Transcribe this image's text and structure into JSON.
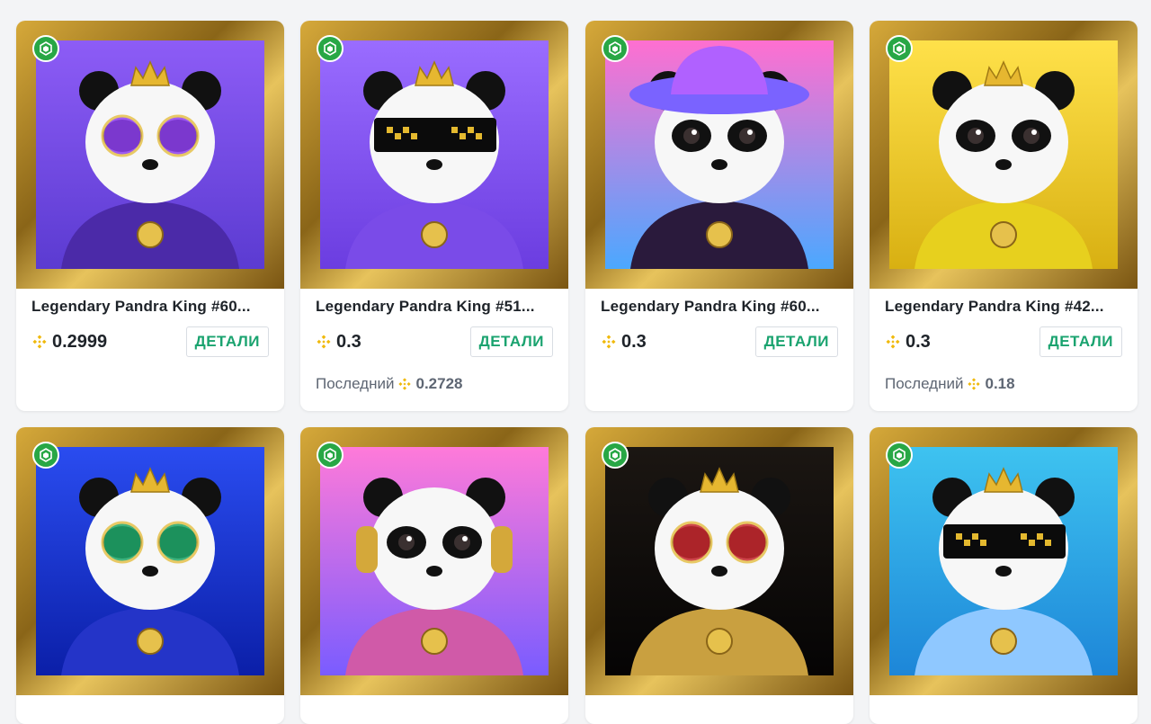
{
  "labels": {
    "details_button": "ДЕТАЛИ",
    "last_price_label": "Последний"
  },
  "colors": {
    "accent_green": "#1aa36f",
    "bnb_yellow": "#f0b90b",
    "frame_gold": "#c9a040"
  },
  "cards": [
    {
      "title": "Legendary Pandra King #60...",
      "price": "0.2999",
      "last": null,
      "bg": [
        "#8d5cf6",
        "#5b3bd1"
      ],
      "accessory": "purple-gem-glasses",
      "outfit": "#4b2aa8"
    },
    {
      "title": "Legendary Pandra King #51...",
      "price": "0.3",
      "last": "0.2728",
      "bg": [
        "#9a6cff",
        "#6b3de0"
      ],
      "accessory": "pixel-sunglasses",
      "outfit": "#7a4be8"
    },
    {
      "title": "Legendary Pandra King #60...",
      "price": "0.3",
      "last": null,
      "bg": [
        "#ff6fd0",
        "#4ba8ff"
      ],
      "accessory": "galaxy-hat",
      "outfit": "#2a1a3c"
    },
    {
      "title": "Legendary Pandra King #42...",
      "price": "0.3",
      "last": "0.18",
      "bg": [
        "#ffe14a",
        "#d8b012"
      ],
      "accessory": "gold-crown",
      "outfit": "#e7d01e"
    },
    {
      "title": "",
      "price": "",
      "last": null,
      "bg": [
        "#2a4cf0",
        "#0b1fa8"
      ],
      "accessory": "gold-round-glasses",
      "outfit": "#2434c8"
    },
    {
      "title": "",
      "price": "",
      "last": null,
      "bg": [
        "#ff7ad9",
        "#7a5cff"
      ],
      "accessory": "headphones",
      "outfit": "#d05aa8"
    },
    {
      "title": "",
      "price": "",
      "last": null,
      "bg": [
        "#1b1612",
        "#050404"
      ],
      "accessory": "ruby-gold-glasses",
      "outfit": "#c9a040"
    },
    {
      "title": "",
      "price": "",
      "last": null,
      "bg": [
        "#3ec3f0",
        "#1d86d8"
      ],
      "accessory": "pixel-sunglasses",
      "outfit": "#8fc8ff"
    }
  ],
  "icons": {
    "chain_badge": "cube-chain-icon",
    "currency": "bnb-coin-icon"
  }
}
